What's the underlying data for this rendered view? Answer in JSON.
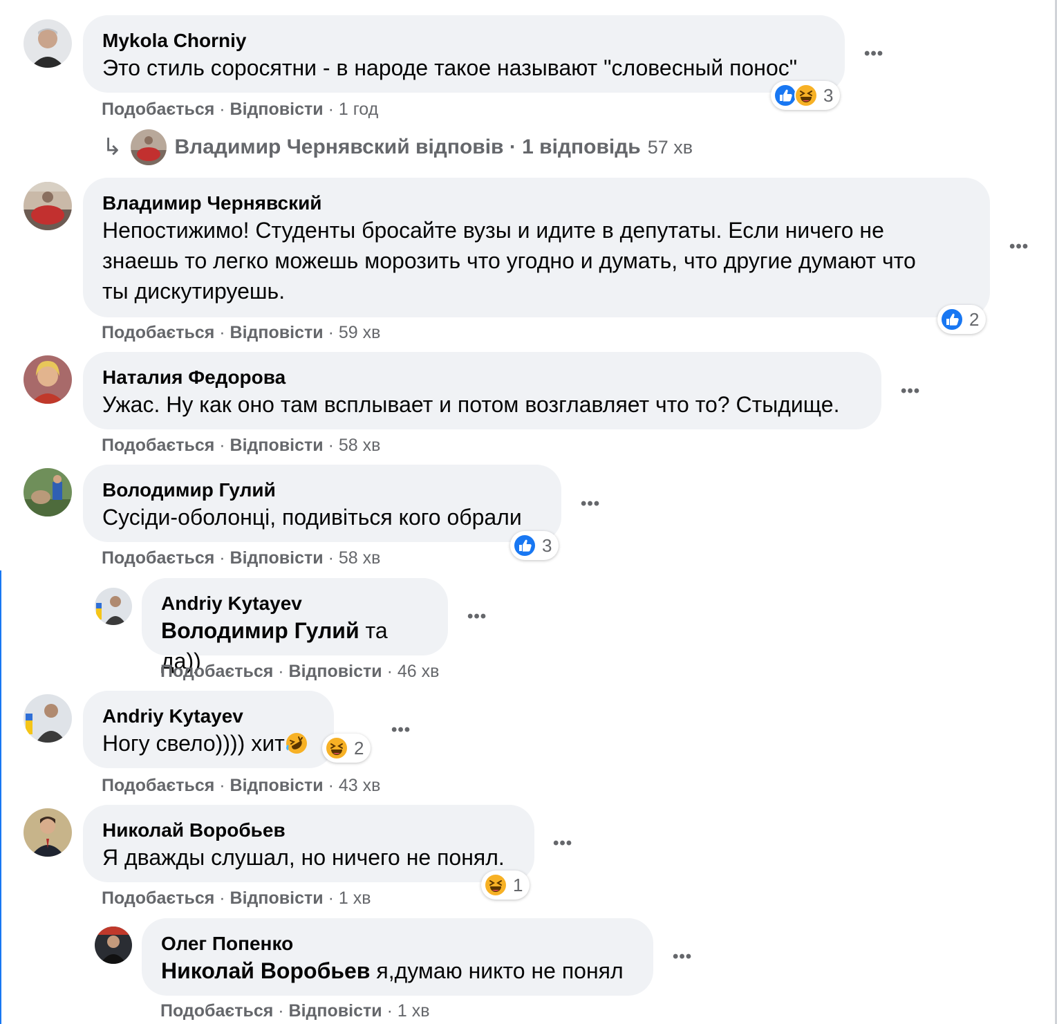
{
  "ui": {
    "like_label": "Подобається",
    "reply_label": "Відповісти",
    "sep": "·",
    "more_label": "•••"
  },
  "colors": {
    "like_blue": "#1877f2",
    "bubble_bg": "#f0f2f5",
    "meta_gray": "#65676b",
    "haha_yellow": "#f7b125"
  },
  "comments": [
    {
      "author": "Mykola Chorniy",
      "text": "Это стиль соросятни - в народе такое называют \"словесный понос\"",
      "time": "1 год",
      "reactions": [
        "like-icon",
        "haha-icon"
      ],
      "reaction_count": "3",
      "replies_summary": {
        "text": "Владимир Чернявский відповів · 1 відповідь",
        "time": "57 хв"
      }
    },
    {
      "author": "Владимир Чернявский",
      "text_lines": [
        "Непостижимо! Студенты бросайте вузы и идите в депутаты. Если ничего не",
        "знаешь то легко можешь морозить что угодно и думать, что другие думают что",
        "ты дискутируешь."
      ],
      "time": "59 хв",
      "reactions": [
        "like-icon"
      ],
      "reaction_count": "2"
    },
    {
      "author": "Наталия Федорова",
      "text": "Ужас. Ну как оно там всплывает и потом возглавляет что то? Стыдище.",
      "time": "58 хв"
    },
    {
      "author": "Володимир Гулий",
      "text": "Сусіди-оболонці, подивіться кого обрали",
      "time": "58 хв",
      "reactions": [
        "like-icon"
      ],
      "reaction_count": "3"
    },
    {
      "author": "Andriy Kytayev",
      "mention": "Володимир Гулий",
      "text": " та да))",
      "time": "46 хв",
      "is_reply": true
    },
    {
      "author": "Andriy Kytayev",
      "text": "Ногу свело)))) хит",
      "emoji": "rofl-icon",
      "time": "43 хв",
      "reactions": [
        "haha-icon"
      ],
      "reaction_count": "2"
    },
    {
      "author": "Николай Воробьев",
      "text": "Я дважды слушал, но ничего не понял.",
      "time": "1 хв",
      "reactions": [
        "haha-icon"
      ],
      "reaction_count": "1"
    },
    {
      "author": "Олег Попенко",
      "mention": "Николай Воробьев",
      "text": " я,думаю никто не понял",
      "time": "1 хв",
      "is_reply": true
    }
  ]
}
